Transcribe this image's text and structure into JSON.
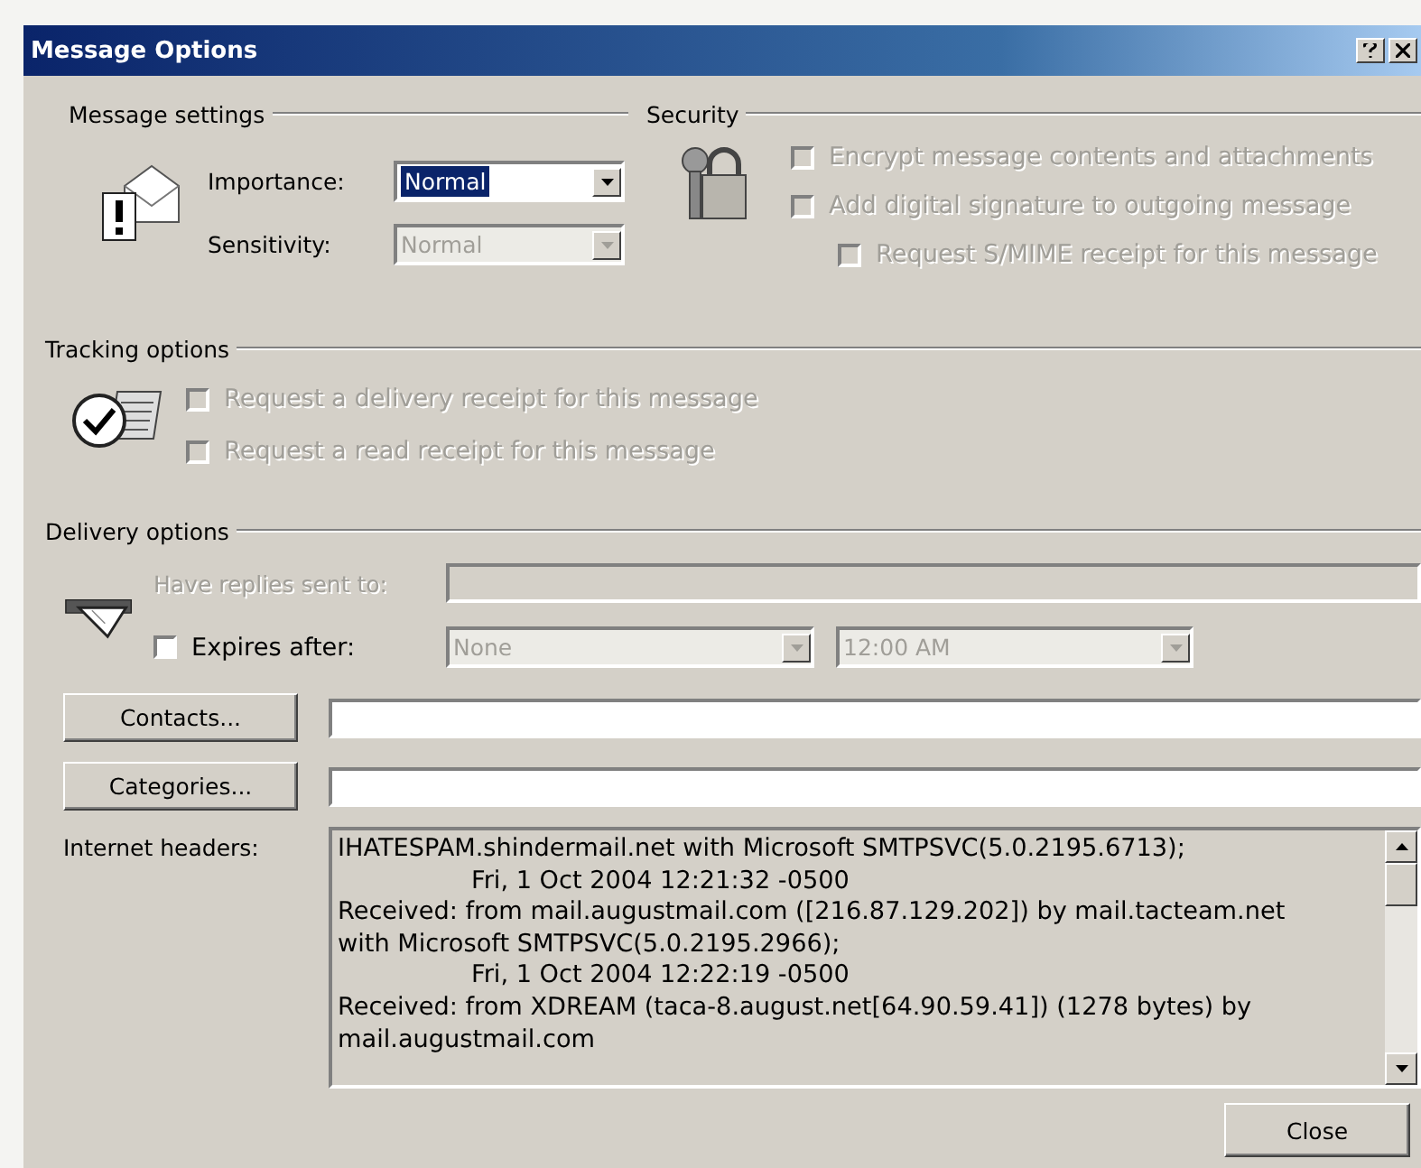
{
  "window": {
    "title": "Message Options"
  },
  "message_settings": {
    "label": "Message settings",
    "fields": [
      {
        "label": "Importance:",
        "value": "Normal",
        "disabled": false,
        "focused": true
      },
      {
        "label": "Sensitivity:",
        "value": "Normal",
        "disabled": true,
        "focused": false
      }
    ]
  },
  "security": {
    "label": "Security",
    "options": [
      {
        "label": "Encrypt message contents and attachments",
        "checked": false,
        "disabled": true
      },
      {
        "label": "Add digital signature to outgoing message",
        "checked": false,
        "disabled": true,
        "children": [
          {
            "label": "Request S/MIME receipt for this message",
            "checked": false,
            "disabled": true
          }
        ]
      }
    ]
  },
  "tracking": {
    "label": "Tracking options",
    "options": [
      {
        "label": "Request a delivery receipt for this message",
        "checked": false,
        "disabled": true
      },
      {
        "label": "Request a read receipt for this message",
        "checked": false,
        "disabled": true
      }
    ]
  },
  "delivery": {
    "label": "Delivery options",
    "reply_to": {
      "label": "Have replies sent to:",
      "disabled": true
    },
    "expires": {
      "label": "Expires after:",
      "checked": false,
      "disabled": false
    },
    "expiry_date": {
      "value": "None",
      "disabled": true
    },
    "expiry_time": {
      "value": "12:00 AM",
      "disabled": true
    }
  },
  "contacts_button": "Contacts...",
  "categories_button": "Categories...",
  "internet_headers": {
    "label": "Internet headers:",
    "lines": [
      {
        "text": "IHATESPAM.shindermail.net with Microsoft SMTPSVC(5.0.2195.6713);",
        "indented": false
      },
      {
        "text": "Fri, 1 Oct 2004 12:21:32 -0500",
        "indented": true
      },
      {
        "text": "Received: from mail.augustmail.com ([216.87.129.202]) by mail.tacteam.net",
        "indented": false
      },
      {
        "text": "with Microsoft SMTPSVC(5.0.2195.2966);",
        "indented": false
      },
      {
        "text": "Fri, 1 Oct 2004 12:22:19 -0500",
        "indented": true
      },
      {
        "text": "Received: from XDREAM (taca-8.august.net[64.90.59.41]) (1278 bytes) by",
        "indented": false
      },
      {
        "text": "mail.augustmail.com",
        "indented": false
      }
    ]
  },
  "buttons": [
    "Close"
  ]
}
